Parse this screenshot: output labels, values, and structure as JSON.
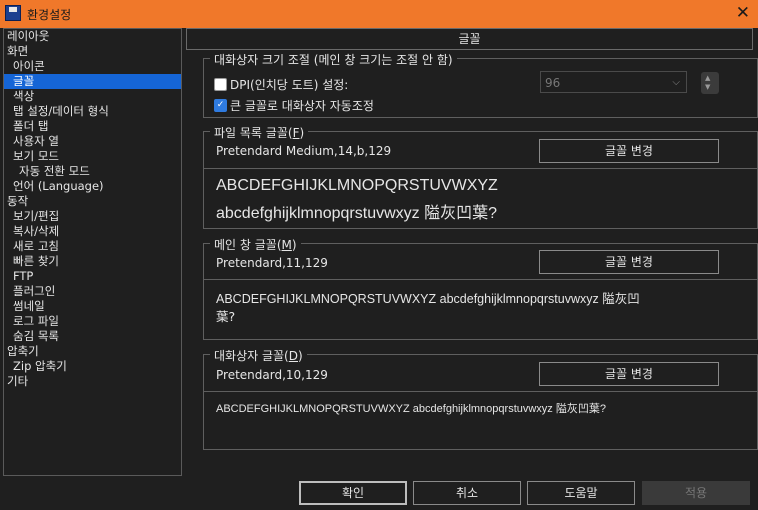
{
  "window": {
    "title": "환경설정",
    "app_icon": "floppy-disk-icon",
    "close_glyph": "✕"
  },
  "sidebar": {
    "items": [
      {
        "label": "레이아웃",
        "level": 0,
        "selected": false
      },
      {
        "label": "화면",
        "level": 0,
        "selected": false
      },
      {
        "label": "아이콘",
        "level": 1,
        "selected": false
      },
      {
        "label": "글꼴",
        "level": 1,
        "selected": true
      },
      {
        "label": "색상",
        "level": 1,
        "selected": false
      },
      {
        "label": "탭 설정/데이터 형식",
        "level": 1,
        "selected": false
      },
      {
        "label": "폴더 탭",
        "level": 1,
        "selected": false
      },
      {
        "label": "사용자 열",
        "level": 1,
        "selected": false
      },
      {
        "label": "보기 모드",
        "level": 1,
        "selected": false
      },
      {
        "label": "자동 전환 모드",
        "level": 2,
        "selected": false
      },
      {
        "label": "언어 (Language)",
        "level": 1,
        "selected": false
      },
      {
        "label": "동작",
        "level": 0,
        "selected": false
      },
      {
        "label": "보기/편집",
        "level": 1,
        "selected": false
      },
      {
        "label": "복사/삭제",
        "level": 1,
        "selected": false
      },
      {
        "label": "새로 고침",
        "level": 1,
        "selected": false
      },
      {
        "label": "빠른 찾기",
        "level": 1,
        "selected": false
      },
      {
        "label": "FTP",
        "level": 1,
        "selected": false
      },
      {
        "label": "플러그인",
        "level": 1,
        "selected": false
      },
      {
        "label": "썸네일",
        "level": 1,
        "selected": false
      },
      {
        "label": "로그 파일",
        "level": 1,
        "selected": false
      },
      {
        "label": "숨김 목록",
        "level": 1,
        "selected": false
      },
      {
        "label": "압축기",
        "level": 0,
        "selected": false
      },
      {
        "label": "Zip 압축기",
        "level": 1,
        "selected": false
      },
      {
        "label": "기타",
        "level": 0,
        "selected": false
      }
    ]
  },
  "section": {
    "title": "글꼴"
  },
  "dialog_size": {
    "legend": "대화상자 크기 조절 (메인 창 크기는 조절 안 함)",
    "dpi_label": "DPI(인치당 도트) 설정:",
    "dpi_checked": false,
    "dpi_value": "96",
    "autosize_label": "큰 글꼴로 대화상자 자동조정",
    "autosize_checked": true
  },
  "file_list_font": {
    "legend_prefix": "파일 목록 글꼴(",
    "legend_key": "F",
    "legend_suffix": ")",
    "font_name": "Pretendard Medium,14,b,129",
    "change_label": "글꼴 변경",
    "preview_line1": "ABCDEFGHIJKLMNOPQRSTUVWXYZ",
    "preview_line2": "abcdefghijklmnopqrstuvwxyz 隘灰凹葉?"
  },
  "main_window_font": {
    "legend_prefix": "메인 창 글꼴(",
    "legend_key": "M",
    "legend_suffix": ")",
    "font_name": "Pretendard,11,129",
    "change_label": "글꼴 변경",
    "preview_line1": "ABCDEFGHIJKLMNOPQRSTUVWXYZ abcdefghijklmnopqrstuvwxyz 隘灰凹",
    "preview_line2": "葉?"
  },
  "dialog_font": {
    "legend_prefix": "대화상자 글꼴(",
    "legend_key": "D",
    "legend_suffix": ")",
    "font_name": "Pretendard,10,129",
    "change_label": "글꼴 변경",
    "preview_line1": "ABCDEFGHIJKLMNOPQRSTUVWXYZ abcdefghijklmnopqrstuvwxyz 隘灰凹葉?"
  },
  "buttons": {
    "ok": "확인",
    "cancel": "취소",
    "help": "도움말",
    "apply": "적용"
  },
  "colors": {
    "titlebar": "#f0782a",
    "selection": "#1565d6",
    "background": "#1f1f1f",
    "checkbox_checked": "#2f7be0"
  }
}
